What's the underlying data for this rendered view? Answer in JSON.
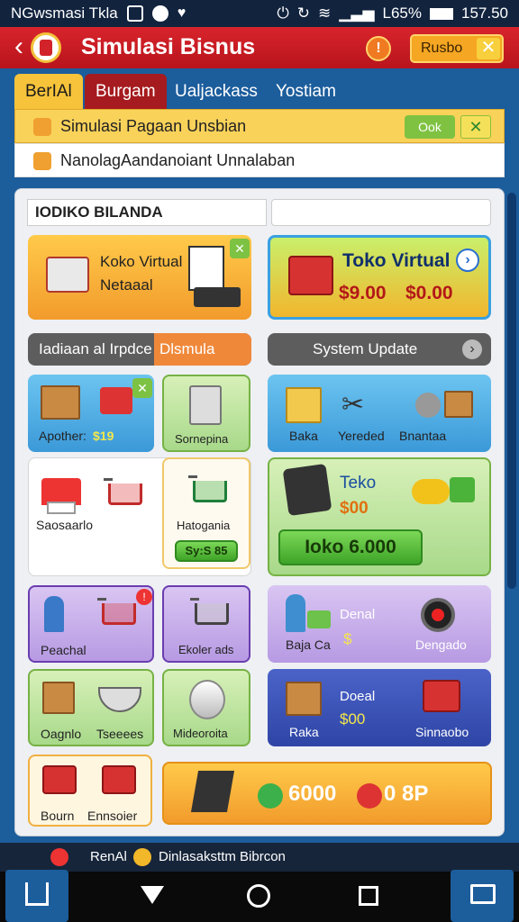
{
  "statusbar": {
    "left_text": "NGwsmasi Tkla",
    "battery": "L65%",
    "time": "157.50"
  },
  "appbar": {
    "title": "Simulasi Bisnus",
    "info": "!",
    "right_button": "Rusbo",
    "right_close": "✕"
  },
  "tabs": [
    {
      "label": "BerIAl"
    },
    {
      "label": "Burgam"
    },
    {
      "label": "Ualjackass"
    },
    {
      "label": "Yostiam"
    }
  ],
  "notices": [
    {
      "text": "Simulasi Pagaan Unsbian",
      "ok": "Ook",
      "close": "✕"
    },
    {
      "text": "NanolagAandanoiant Unnalaban"
    }
  ],
  "section": {
    "title": "IODIKO BILANDA"
  },
  "cards": {
    "top_left": {
      "line1": "Koko Virtual",
      "line2": "Netaaal"
    },
    "top_right": {
      "title": "Toko Virtual",
      "price1": "$9.00",
      "price2": "$0.00"
    },
    "promo_left": {
      "text": "Iadiaan al Irpdce",
      "badge": "Dlsmula"
    },
    "promo_right": {
      "text": "System Update"
    },
    "apother": {
      "label": "Apother:",
      "price": "$19"
    },
    "sornepina": {
      "label": "Sornepina"
    },
    "row2_right": {
      "l1": "Baka",
      "l2": "Yereded",
      "l3": "Bnantaa"
    },
    "saosaarlo": {
      "label": "Saosaarlo"
    },
    "hatogania": {
      "label": "Hatogania",
      "button": "Sy:S 85"
    },
    "teko": {
      "title": "Teko",
      "price": "$00",
      "button": "Ioko 6.000"
    },
    "peachal": {
      "label": "Peachal",
      "badge": "!"
    },
    "ekolerads": {
      "label": "Ekoler ads"
    },
    "denal": {
      "title": "Denal",
      "l1": "Baja Ca",
      "price": "$",
      "l2": "Dengado"
    },
    "oagnlo": {
      "label": "Oagnlo"
    },
    "tseeees": {
      "label": "Tseeees"
    },
    "mideoroita": {
      "label": "Mideoroita"
    },
    "doeal": {
      "title": "Doeal",
      "price": "$00",
      "l1": "Raka",
      "l2": "Sinnaobo"
    },
    "bottom_left": {
      "l1": "Bourn",
      "l2": "Ennsoier"
    },
    "bottom_bar": {
      "amount": "6000",
      "suffix": "0 8P"
    }
  },
  "bottom_strip": {
    "l1": "RenAl",
    "l2": "Dinlasaksttm Bibrcon"
  },
  "nav": {
    "home": "home-icon",
    "back": "back-icon",
    "home2": "circle-home-icon",
    "recent": "recent-icon",
    "cast": "cast-icon"
  }
}
